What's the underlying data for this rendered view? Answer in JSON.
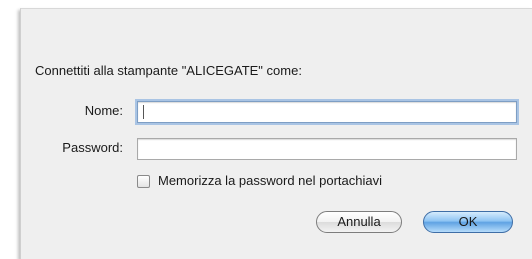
{
  "dialog": {
    "prompt": "Connettiti alla stampante \"ALICEGATE\" come:",
    "name_label": "Nome:",
    "name_value": "",
    "password_label": "Password:",
    "password_value": "",
    "keychain_label": "Memorizza la password nel portachiavi",
    "keychain_checked": false,
    "cancel_label": "Annulla",
    "ok_label": "OK"
  }
}
